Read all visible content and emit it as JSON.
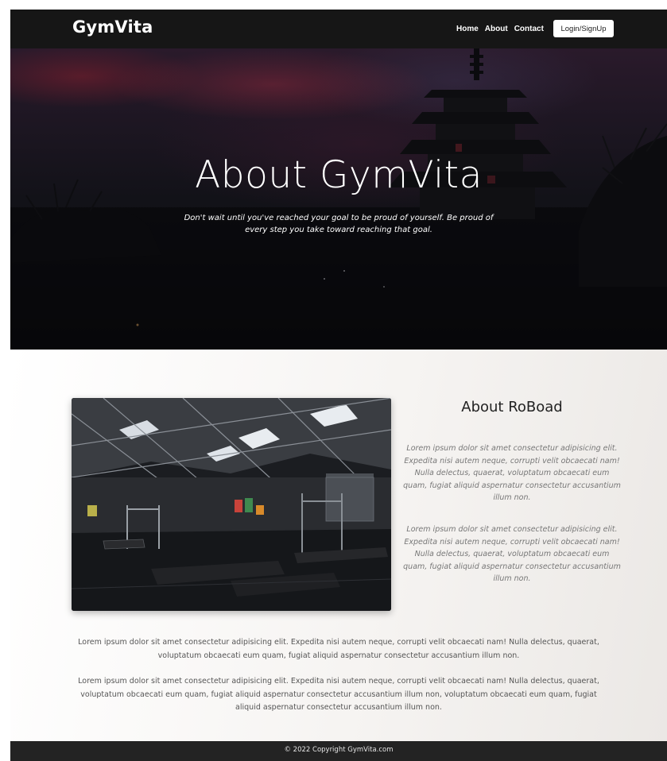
{
  "navbar": {
    "brand": "GymVita",
    "links": [
      "Home",
      "About",
      "Contact"
    ],
    "login_label": "Login/SignUp"
  },
  "hero": {
    "title": "About GymVita",
    "subtitle": "Don't wait until you've reached your goal to be proud of yourself. Be proud of every step you take toward reaching that goal."
  },
  "about": {
    "heading": "About RoBoad",
    "paragraphs": [
      "Lorem ipsum dolor sit amet consectetur adipisicing elit. Expedita nisi autem neque, corrupti velit obcaecati nam! Nulla delectus, quaerat, voluptatum obcaecati eum quam, fugiat aliquid aspernatur consectetur accusantium illum non.",
      "Lorem ipsum dolor sit amet consectetur adipisicing elit. Expedita nisi autem neque, corrupti velit obcaecati nam! Nulla delectus, quaerat, voluptatum obcaecati eum quam, fugiat aliquid aspernatur consectetur accusantium illum non."
    ],
    "body": [
      "Lorem ipsum dolor sit amet consectetur adipisicing elit. Expedita nisi autem neque, corrupti velit obcaecati nam! Nulla delectus, quaerat, voluptatum obcaecati eum quam, fugiat aliquid aspernatur consectetur accusantium illum non.",
      "Lorem ipsum dolor sit amet consectetur adipisicing elit. Expedita nisi autem neque, corrupti velit obcaecati nam! Nulla delectus, quaerat, voluptatum obcaecati eum quam, fugiat aliquid aspernatur consectetur accusantium illum non, voluptatum obcaecati eum quam, fugiat aliquid aspernatur consectetur accusantium illum non."
    ]
  },
  "footer": {
    "copyright": "© 2022 Copyright GymVita.com"
  },
  "colors": {
    "navbar_bg": "#161616",
    "footer_bg": "#232323",
    "hero_dark": "#08080b",
    "hero_red": "#8c283c",
    "heading_text": "#222222",
    "muted_text": "#777777"
  },
  "images": {
    "hero_background": "pagoda-silhouette-sunset",
    "gym_photo": "gym-interior"
  }
}
